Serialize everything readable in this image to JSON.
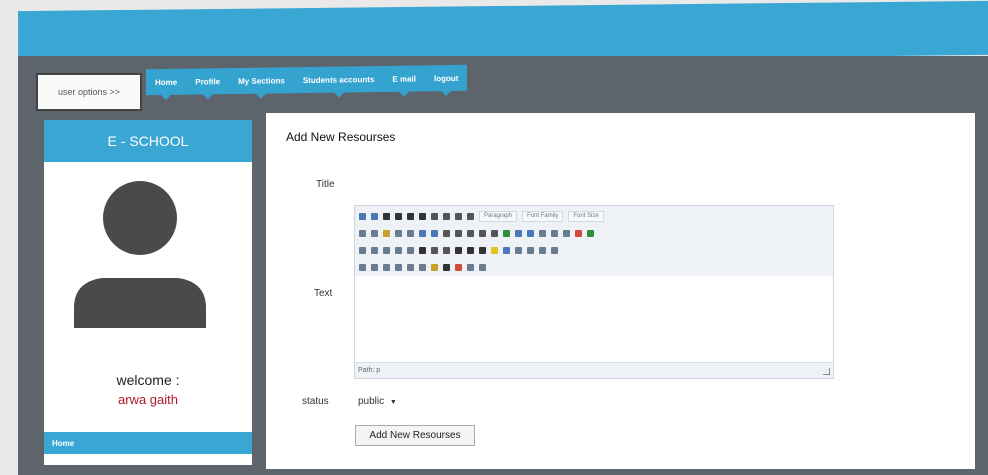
{
  "nav": {
    "user_options": "user options >>",
    "items": [
      "Home",
      "Profile",
      "My Sections",
      "Students accounts",
      "E mail",
      "logout"
    ]
  },
  "sidebar": {
    "title": "E - SCHOOL",
    "welcome": "welcome :",
    "username": "arwa gaith",
    "home": "Home"
  },
  "main": {
    "title": "Add New Resourses",
    "title_label": "Title",
    "text_label": "Text",
    "status_label": "status",
    "status_value": "public",
    "submit": "Add New Resourses"
  },
  "editor": {
    "format_select": "Paragraph",
    "font_family_select": "Font Family",
    "font_size_select": "Font Size",
    "path": "Path: p"
  },
  "colors": {
    "accent": "#3aa6d3",
    "frame": "#5e646c",
    "username": "#b0162b"
  }
}
